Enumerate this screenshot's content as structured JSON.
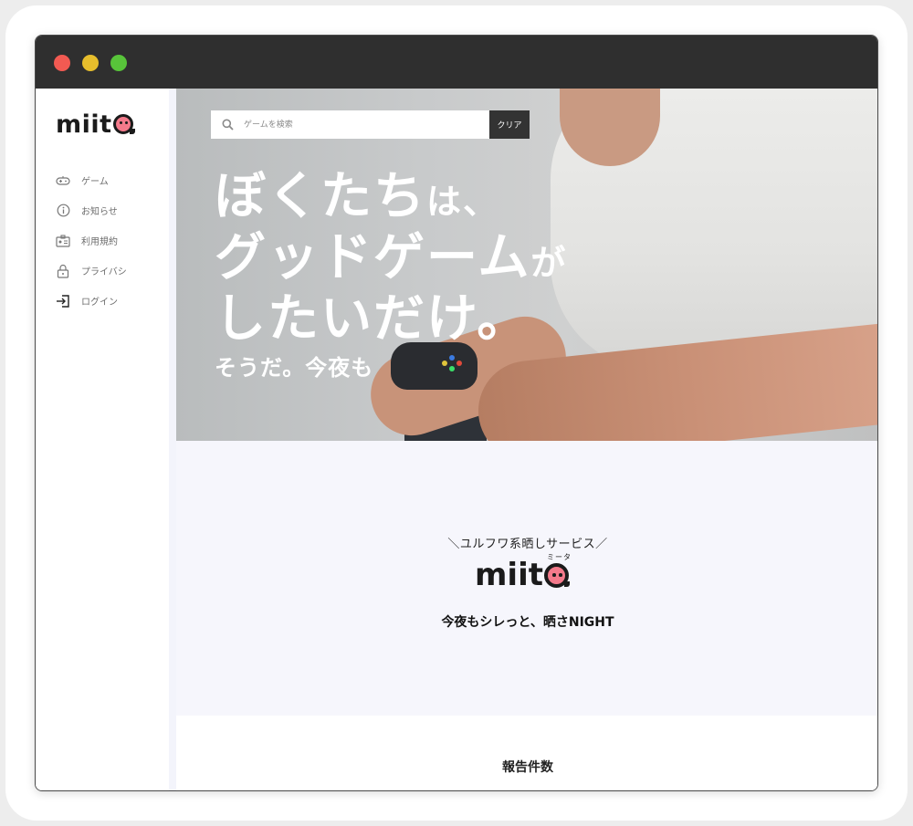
{
  "sidebar": {
    "logo": "miit",
    "items": [
      {
        "label": "ゲーム",
        "icon": "gamepad-icon"
      },
      {
        "label": "お知らせ",
        "icon": "info-icon"
      },
      {
        "label": "利用規約",
        "icon": "id-card-icon"
      },
      {
        "label": "プライバシ",
        "icon": "lock-icon"
      },
      {
        "label": "ログイン",
        "icon": "login-icon"
      }
    ]
  },
  "search": {
    "placeholder": "ゲームを検索",
    "clear_label": "クリア",
    "icon": "search-icon"
  },
  "hero": {
    "line1_main": "ぼくたち",
    "line1_tail": "は、",
    "line2_main": "グッドゲーム",
    "line2_tail": "が",
    "line3": "したいだけ。",
    "sub": "そうだ。今夜も"
  },
  "intro": {
    "tagline": "＼ユルフワ系晒しサービス／",
    "ruby": "ミータ",
    "logo": "miit",
    "catch": "今夜もシレっと、晒さNIGHT"
  },
  "reports": {
    "title": "報告件数"
  },
  "colors": {
    "titlebar": "#2f2f2f",
    "accent_pink": "#f47a8b",
    "clear_button": "#333333",
    "intro_bg": "#f6f6fc"
  }
}
